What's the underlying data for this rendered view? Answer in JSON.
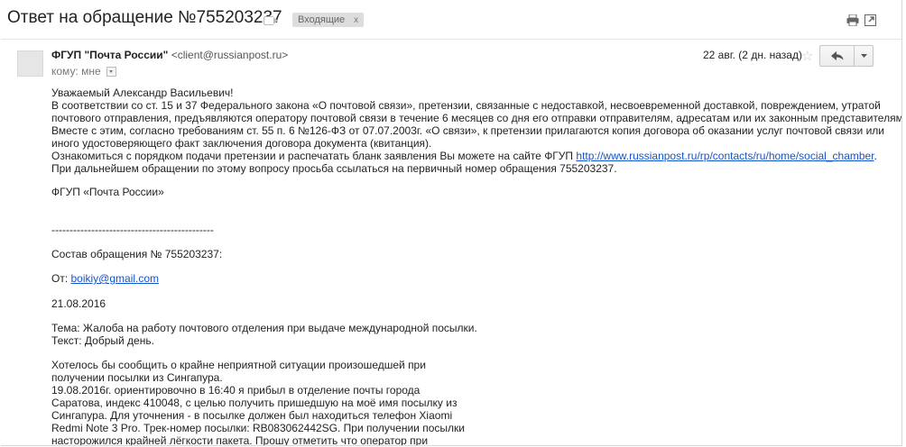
{
  "header": {
    "subject": "Ответ на обращение №755203237",
    "inbox_chip": "Входящие",
    "inbox_chip_close": "x",
    "print_icon": "print-icon",
    "newwin_icon": "new-window-icon"
  },
  "message": {
    "sender_name": "ФГУП \"Почта России\"",
    "sender_email": "<client@russianpost.ru>",
    "to_label": "кому: мне",
    "date": "22 авг. (2 дн. назад)",
    "star_glyph": "☆",
    "reply_icon": "reply-icon",
    "more_icon": "chevron-down-icon"
  },
  "body": {
    "greeting": "Уважаемый Александр Васильевич!",
    "para1_l1": "В соответствии со ст. 15 и 37 Федерального закона «О почтовой связи», претензии, связанные с недоставкой, несвоевременной доставкой, повреждением, утратой",
    "para1_l2": "почтового отправления, предъявляются оператору почтовой связи в течение 6 месяцев со дня его отправки отправителям, адресатам или их законным представителям.",
    "para1_l3": "Вместе с этим, согласно требованиям ст. 55 п. 6 №126-ФЗ от 07.07.2003г. «О связи», к претензии прилагаются копия договора об оказании услуг почтовой связи или",
    "para1_l4": "иного удостоверяющего факт заключения договора документа (квитанция).",
    "para1_l5_pre": "Ознакомиться с порядком подачи претензии и распечатать бланк заявления Вы можете на сайте ФГУП ",
    "para1_l5_link": "http://www.russianpost.ru/rp/contacts/ru/home/social_chamber",
    "para1_l5_post": ".",
    "para1_l6": "При дальнейшем обращении по этому вопросу просьба ссылаться на первичный номер обращения 755203237.",
    "signature": "ФГУП «Почта России»",
    "separator": "---------------------------------------------",
    "request_title": "Состав обращения № 755203237:",
    "from_label": "От: ",
    "from_email": "boikiy@gmail.com",
    "request_date": "21.08.2016",
    "topic": "Тема:  Жалоба на работу почтового отделения при выдаче международной посылки.",
    "text_label": "Текст:  Добрый день.",
    "story_l1": "Хотелось бы сообщить о крайне неприятной ситуации произошедшей при",
    "story_l2": "получении посылки из Сингапура.",
    "story_l3": "19.08.2016г. ориентировочно в 16:40 я прибыл в отделение почты города",
    "story_l4": "Саратова, индекс 410048, с целью получить пришедшую на моё имя посылку из",
    "story_l5": "Сингапура. Для уточнения - в посылке должен был находиться телефон Xiaomi",
    "story_l6": "Redmi Note 3 Pro. Трек-номер посылки: RB083062442SG. При получении посылки",
    "story_l7": "насторожился крайней лёгкости пакета. Прошу отметить что оператор при"
  }
}
